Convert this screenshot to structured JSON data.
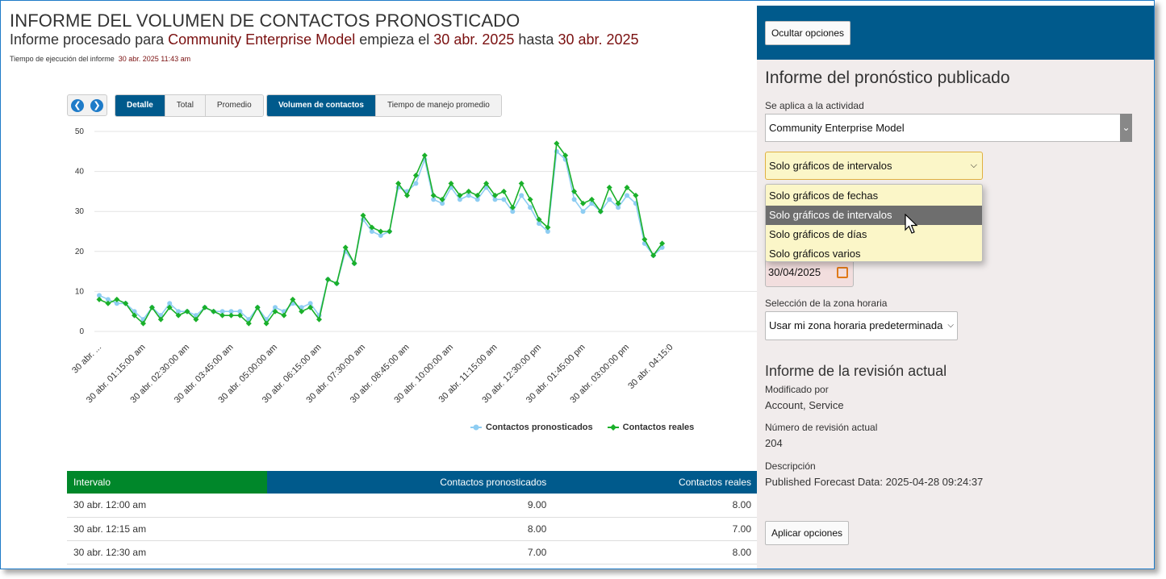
{
  "header": {
    "title": "INFORME DEL VOLUMEN DE CONTACTOS PRONOSTICADO",
    "subtitle_prefix": "Informe procesado para",
    "activity": "Community Enterprise Model",
    "starts_label": "empieza el",
    "start_date": "30 abr. 2025",
    "until_label": "hasta",
    "end_date": "30 abr. 2025",
    "exec_label": "Tiempo de ejecución del informe",
    "exec_time": "30 abr. 2025 11:43 am"
  },
  "toolbar": {
    "prev_icon": "arrow-left-icon",
    "next_icon": "arrow-right-icon",
    "view_tabs": [
      {
        "label": "Detalle",
        "active": true
      },
      {
        "label": "Total",
        "active": false
      },
      {
        "label": "Promedio",
        "active": false
      }
    ],
    "metric_tabs": [
      {
        "label": "Volumen de contactos",
        "active": true
      },
      {
        "label": "Tiempo de manejo promedio",
        "active": false
      }
    ]
  },
  "chart_data": {
    "type": "line",
    "title": "",
    "xlabel": "",
    "ylabel": "",
    "ylim": [
      0,
      50
    ],
    "yticks": [
      0,
      10,
      20,
      30,
      40,
      50
    ],
    "grid": true,
    "legend_placement": "bottom",
    "x_tick_labels": [
      "30 abr. ...",
      "30 abr. 01:15:00 am",
      "30 abr. 02:30:00 am",
      "30 abr. 03:45:00 am",
      "30 abr. 05:00:00 am",
      "30 abr. 06:15:00 am",
      "30 abr. 07:30:00 am",
      "30 abr. 08:45:00 am",
      "30 abr. 10:00:00 am",
      "30 abr. 11:15:00 am",
      "30 abr. 12:30:00 pm",
      "30 abr. 01:45:00 pm",
      "30 abr. 03:00:00 pm",
      "30 abr. 04:15:0"
    ],
    "series": [
      {
        "name": "Contactos pronosticados",
        "color": "#8ecdf2",
        "values": [
          9,
          8,
          7,
          7,
          5,
          3,
          6,
          4,
          7,
          5,
          5,
          4,
          6,
          5,
          5,
          5,
          5,
          3,
          6,
          3,
          6,
          5,
          7,
          6,
          7,
          4,
          13,
          12,
          20,
          17,
          28,
          25,
          24,
          25,
          36,
          35,
          37,
          43,
          33,
          32,
          36,
          33,
          34,
          33,
          36,
          33,
          33,
          30,
          34,
          31,
          27,
          25,
          45,
          43,
          33,
          30,
          32,
          30,
          33,
          31,
          34,
          32,
          22,
          19,
          21
        ]
      },
      {
        "name": "Contactos reales",
        "color": "#1ab02a",
        "values": [
          8,
          7,
          8,
          7,
          4,
          2,
          6,
          3,
          6,
          4,
          5,
          3,
          6,
          5,
          4,
          4,
          4,
          2,
          6,
          2,
          5,
          4,
          8,
          5,
          6,
          3,
          13,
          12,
          21,
          17,
          29,
          26,
          25,
          25,
          37,
          34,
          39,
          44,
          34,
          33,
          37,
          34,
          35,
          34,
          37,
          34,
          35,
          31,
          37,
          33,
          28,
          26,
          47,
          44,
          35,
          32,
          33,
          30,
          36,
          32,
          36,
          34,
          23,
          19,
          22
        ]
      }
    ]
  },
  "table": {
    "headers": [
      "Intervalo",
      "Contactos pronosticados",
      "Contactos reales"
    ],
    "rows": [
      [
        "30 abr. 12:00 am",
        "9.00",
        "8.00"
      ],
      [
        "30 abr. 12:15 am",
        "8.00",
        "7.00"
      ],
      [
        "30 abr. 12:30 am",
        "7.00",
        "8.00"
      ]
    ]
  },
  "panel": {
    "hide_button": "Ocultar opciones",
    "pub_title": "Informe del pronóstico publicado",
    "activity_label": "Se aplica a la actividad",
    "activity_value": "Community Enterprise Model",
    "chart_select_value": "Solo gráficos de intervalos",
    "chart_options": [
      {
        "label": "Solo gráficos de fechas",
        "selected": false
      },
      {
        "label": "Solo gráficos de intervalos",
        "selected": true
      },
      {
        "label": "Solo gráficos de días",
        "selected": false
      },
      {
        "label": "Solo gráficos varios",
        "selected": false
      }
    ],
    "date_value": "30/04/2025",
    "calendar_icon": "calendar-icon",
    "tz_label": "Selección de la zona horaria",
    "tz_value": "Usar mi zona horaria predeterminada",
    "rev_title": "Informe de la revisión actual",
    "modified_label": "Modificado por",
    "modified_value": "Account, Service",
    "rev_num_label": "Número de revisión actual",
    "rev_num_value": "204",
    "desc_label": "Descripción",
    "desc_value": "Published Forecast Data: 2025-04-28 09:24:37",
    "apply_button": "Aplicar opciones",
    "accent_color": "#005a8c"
  }
}
